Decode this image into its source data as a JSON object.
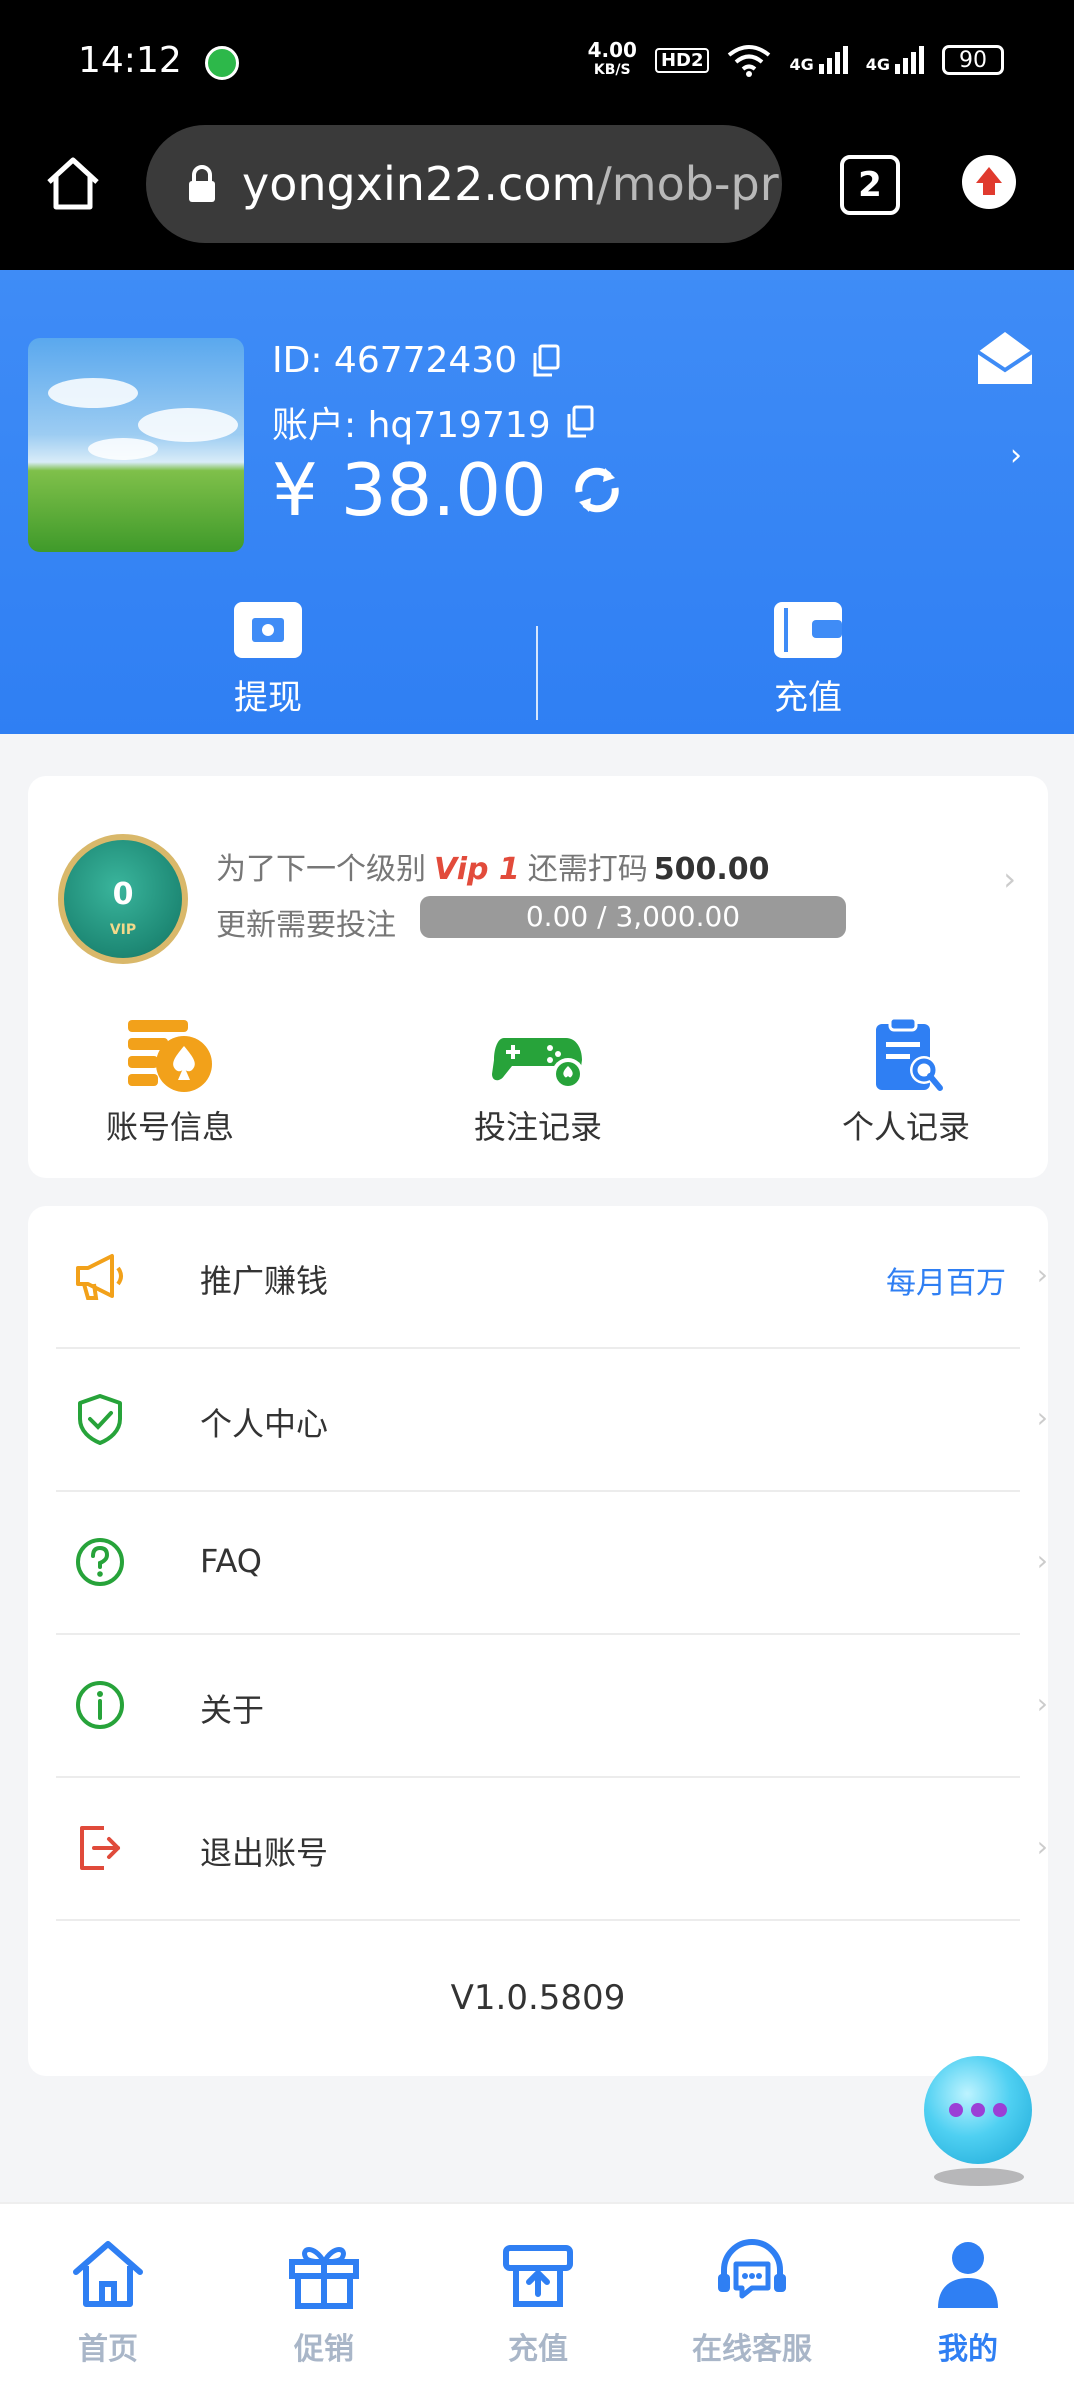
{
  "status_bar": {
    "time": "14:12",
    "net_speed_value": "4.00",
    "net_speed_unit": "KB/S",
    "hd_label": "HD2",
    "signal_1": "4G",
    "signal_2": "4G",
    "battery": "90"
  },
  "browser": {
    "url_domain": "yongxin22.com",
    "url_path": "/mob-pr",
    "tab_count": "2"
  },
  "profile": {
    "id_label": "ID: 46772430",
    "account_label": "账户: hq719719",
    "balance": "¥ 38.00",
    "withdraw_label": "提现",
    "recharge_label": "充值"
  },
  "vip": {
    "line1_prefix": "为了下一个级别",
    "next_level": "Vip 1",
    "line1_mid": "还需打码",
    "line1_amount": "500.00",
    "line2_label": "更新需要投注",
    "progress_text": "0.00 / 3,000.00",
    "progress_current": 0.0,
    "progress_target": 3000.0,
    "badge_level": "0",
    "badge_caption": "VIP"
  },
  "shortcuts": [
    {
      "label": "账号信息",
      "icon": "account-info-icon"
    },
    {
      "label": "投注记录",
      "icon": "gamepad-icon"
    },
    {
      "label": "个人记录",
      "icon": "clipboard-search-icon"
    }
  ],
  "menu": {
    "promote": {
      "label": "推广赚钱",
      "extra": "每月百万"
    },
    "personal_center": {
      "label": "个人中心"
    },
    "faq": {
      "label": "FAQ"
    },
    "about": {
      "label": "关于"
    },
    "logout": {
      "label": "退出账号"
    },
    "version": "V1.0.5809"
  },
  "bottom_nav": [
    {
      "label": "首页"
    },
    {
      "label": "促销"
    },
    {
      "label": "充值"
    },
    {
      "label": "在线客服"
    },
    {
      "label": "我的"
    }
  ],
  "colors": {
    "brand_blue": "#2f7ff3",
    "header_blue": "#3f8cf6",
    "vip_red": "#e24b3b",
    "green_icon": "#27a33a",
    "orange_icon": "#f2a11a",
    "red_icon": "#e04a3a",
    "nav_inactive": "#a9b6c8"
  }
}
